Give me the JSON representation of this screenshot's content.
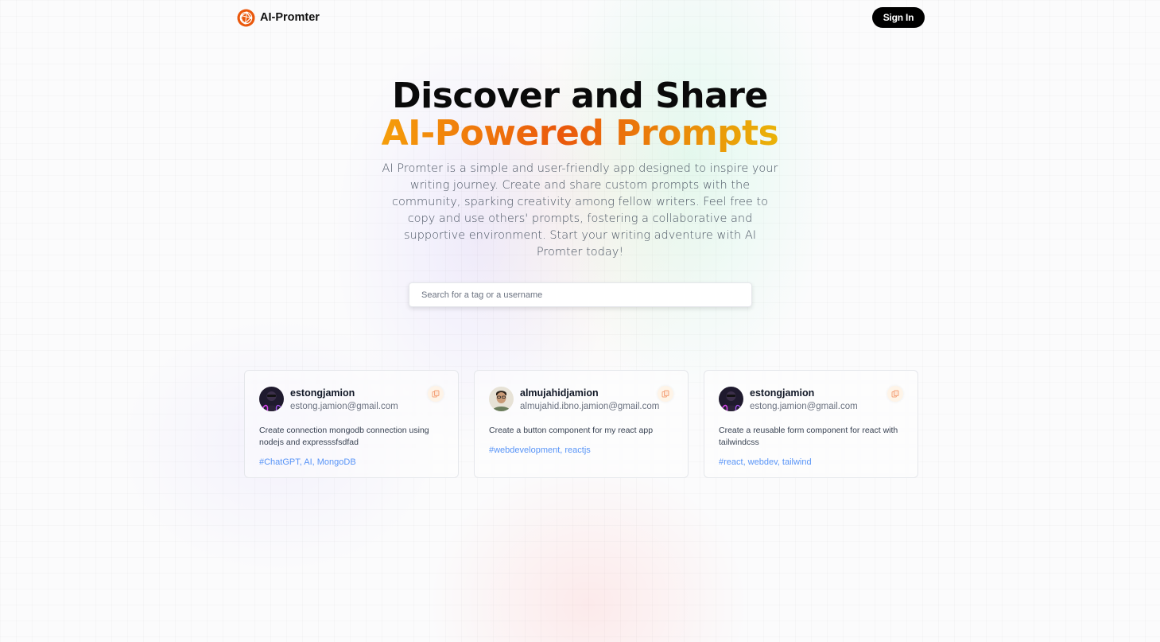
{
  "brand": {
    "name": "AI-Promter",
    "logo_icon": "logo-icon"
  },
  "nav": {
    "signin_label": "Sign In"
  },
  "hero": {
    "title_line1": "Discover and Share",
    "title_line2": "AI-Powered Prompts",
    "description": "AI Promter is a simple and user-friendly app designed to inspire your writing journey. Create and share custom prompts with the community, sparking creativity among fellow writers. Feel free to copy and use others' prompts, fostering a collaborative and supportive environment. Start your writing adventure with AI Promter today!"
  },
  "search": {
    "placeholder": "Search for a tag or a username",
    "value": ""
  },
  "cards": [
    {
      "username": "estongjamion",
      "email": "estong.jamion@gmail.com",
      "prompt": "Create connection mongodb connection using nodejs and expresssfsdfad",
      "tags": "#ChatGPT, AI, MongoDB"
    },
    {
      "username": "almujahidjamion",
      "email": "almujahid.ibno.jamion@gmail.com",
      "prompt": "Create a button component for my react app",
      "tags": "#webdevelopment, reactjs"
    },
    {
      "username": "estongjamion",
      "email": "estong.jamion@gmail.com",
      "prompt": "Create a reusable form component for react with tailwindcss",
      "tags": "#react, webdev, tailwind"
    }
  ],
  "colors": {
    "accent_orange": "#ea580c",
    "gradient_start": "#f59e0b",
    "gradient_end": "#eab308",
    "tag_blue": "#3b82f6",
    "button_black": "#000000"
  }
}
